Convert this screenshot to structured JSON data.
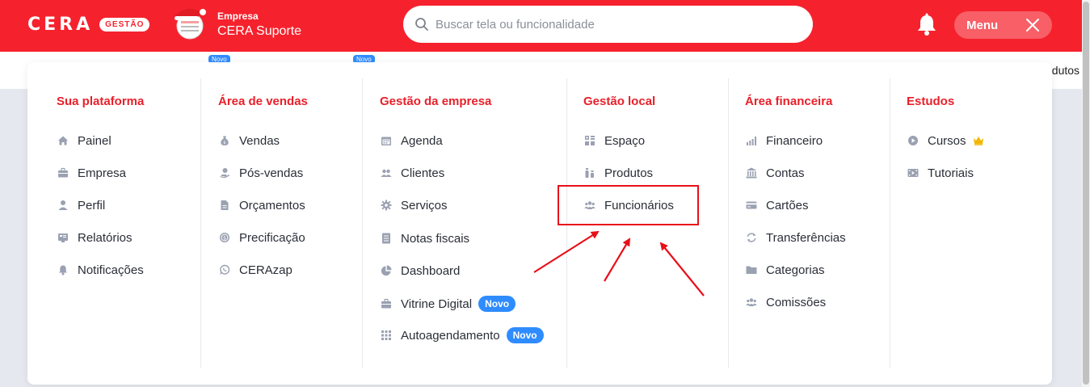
{
  "header": {
    "logo_text": "CERA",
    "logo_badge": "GESTÃO",
    "company_label": "Empresa",
    "company_name": "CERA Suporte",
    "search_placeholder": "Buscar tela ou funcionalidade",
    "menu_label": "Menu"
  },
  "subbar": {
    "partial_text": "odutos",
    "tab_badges": [
      "Novo",
      "Novo"
    ]
  },
  "menu": {
    "columns": [
      {
        "title": "Sua plataforma",
        "items": [
          {
            "label": "Painel",
            "icon": "home-icon"
          },
          {
            "label": "Empresa",
            "icon": "briefcase-icon"
          },
          {
            "label": "Perfil",
            "icon": "user-icon"
          },
          {
            "label": "Relatórios",
            "icon": "report-icon"
          },
          {
            "label": "Notificações",
            "icon": "bell-icon"
          }
        ]
      },
      {
        "title": "Área de vendas",
        "items": [
          {
            "label": "Vendas",
            "icon": "money-bag-icon"
          },
          {
            "label": "Pós-vendas",
            "icon": "hand-money-icon"
          },
          {
            "label": "Orçamentos",
            "icon": "document-icon"
          },
          {
            "label": "Precificação",
            "icon": "coin-icon"
          },
          {
            "label": "CERAzap",
            "icon": "whatsapp-icon"
          }
        ]
      },
      {
        "title": "Gestão da empresa",
        "items": [
          {
            "label": "Agenda",
            "icon": "calendar-icon"
          },
          {
            "label": "Clientes",
            "icon": "users-icon"
          },
          {
            "label": "Serviços",
            "icon": "gear-icon"
          },
          {
            "label": "Notas fiscais",
            "icon": "invoice-icon"
          },
          {
            "label": "Dashboard",
            "icon": "pie-chart-icon"
          },
          {
            "label": "Vitrine Digital",
            "icon": "briefcase-icon",
            "badge": "Novo"
          },
          {
            "label": "Autoagendamento",
            "icon": "calendar-grid-icon",
            "badge": "Novo"
          }
        ]
      },
      {
        "title": "Gestão local",
        "items": [
          {
            "label": "Espaço",
            "icon": "grid-icon"
          },
          {
            "label": "Produtos",
            "icon": "bottles-icon"
          },
          {
            "label": "Funcionários",
            "icon": "team-icon"
          }
        ]
      },
      {
        "title": "Área financeira",
        "items": [
          {
            "label": "Financeiro",
            "icon": "bar-chart-icon"
          },
          {
            "label": "Contas",
            "icon": "bank-icon"
          },
          {
            "label": "Cartões",
            "icon": "credit-card-icon"
          },
          {
            "label": "Transferências",
            "icon": "sync-icon"
          },
          {
            "label": "Categorias",
            "icon": "folder-icon"
          },
          {
            "label": "Comissões",
            "icon": "team-icon"
          }
        ]
      },
      {
        "title": "Estudos",
        "items": [
          {
            "label": "Cursos",
            "icon": "play-circle-icon",
            "crown": true
          },
          {
            "label": "Tutoriais",
            "icon": "video-icon"
          }
        ]
      }
    ]
  },
  "colors": {
    "brand_red": "#f5222d",
    "title_red": "#e8202a",
    "badge_blue": "#2f8cff",
    "icon_gray": "#9aa1b1",
    "highlight_red": "#e8101a"
  }
}
